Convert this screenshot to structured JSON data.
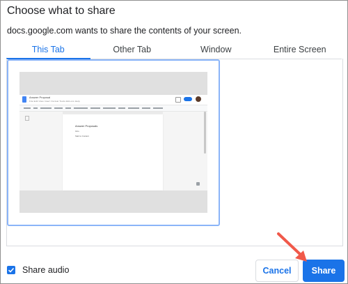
{
  "dialog": {
    "title": "Choose what to share",
    "subtitle": "docs.google.com wants to share the contents of your screen."
  },
  "tabs": [
    {
      "label": "This Tab",
      "active": true
    },
    {
      "label": "Other Tab",
      "active": false
    },
    {
      "label": "Window",
      "active": false
    },
    {
      "label": "Entire Screen",
      "active": false
    }
  ],
  "preview": {
    "doc_title": "Answer Proposal",
    "doc_menu": "File  Edit  View  Insert  Format  Tools  Add-ons  Help",
    "page_heading": "Answer Proposals",
    "page_line1": "Intro",
    "page_line2": "Start to Content"
  },
  "footer": {
    "share_audio_label": "Share audio",
    "share_audio_checked": true,
    "cancel_label": "Cancel",
    "share_label": "Share"
  },
  "colors": {
    "accent": "#1a73e8",
    "arrow": "#f0594a"
  }
}
